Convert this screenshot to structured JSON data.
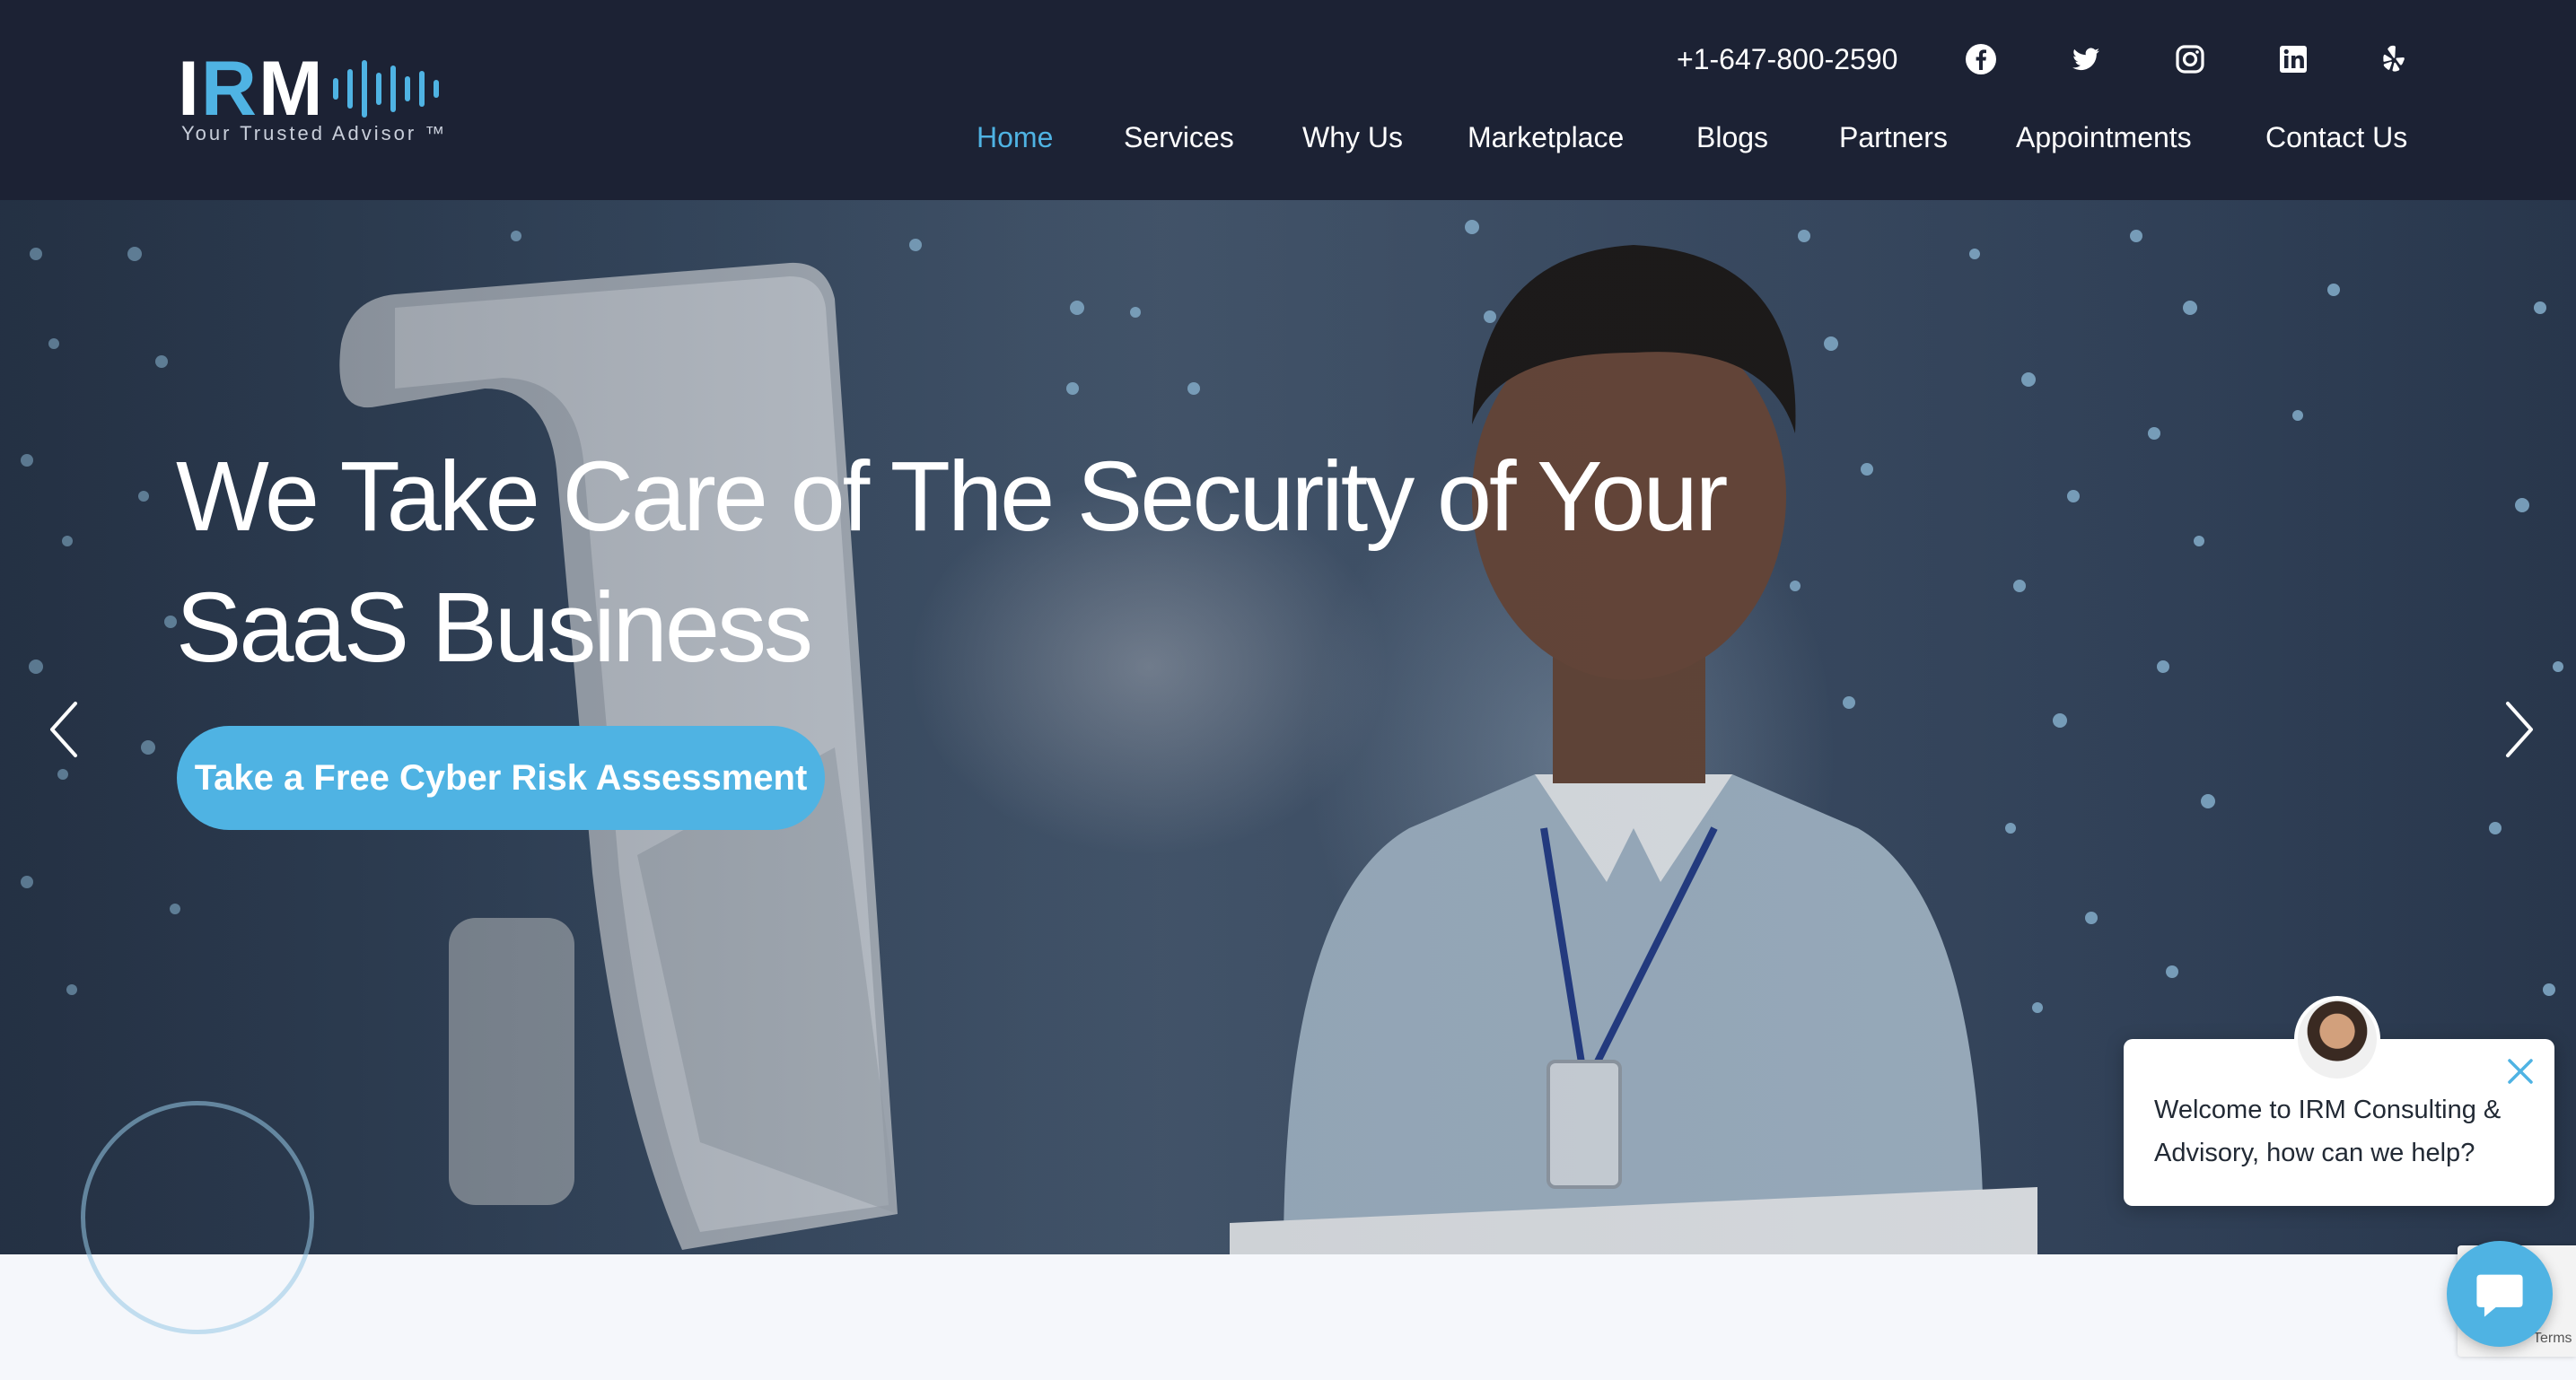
{
  "brand": {
    "logo_text_i": "I",
    "logo_text_r": "R",
    "logo_text_m": "M",
    "tagline": "Your Trusted Advisor ™",
    "accent_color": "#4fb3e3",
    "header_bg": "#1c2234"
  },
  "topbar": {
    "phone": "+1-647-800-2590",
    "social": [
      "facebook-icon",
      "twitter-icon",
      "instagram-icon",
      "linkedin-icon",
      "yelp-icon"
    ]
  },
  "nav": {
    "items": [
      {
        "label": "Home",
        "active": true
      },
      {
        "label": "Services",
        "active": false
      },
      {
        "label": "Why Us",
        "active": false
      },
      {
        "label": "Marketplace",
        "active": false
      },
      {
        "label": "Blogs",
        "active": false
      },
      {
        "label": "Partners",
        "active": false
      },
      {
        "label": "Appointments",
        "active": false
      },
      {
        "label": "Contact Us",
        "active": false
      }
    ]
  },
  "hero": {
    "headline_line1": "We Take Care of The Security of Your",
    "headline_line2": "SaaS Business",
    "cta_label": "Take a Free Cyber Risk Assessment"
  },
  "chat": {
    "message_line1": "Welcome to IRM Consulting &",
    "message_line2": "Advisory, how can we help?"
  },
  "recaptcha": {
    "terms": "Terms"
  }
}
